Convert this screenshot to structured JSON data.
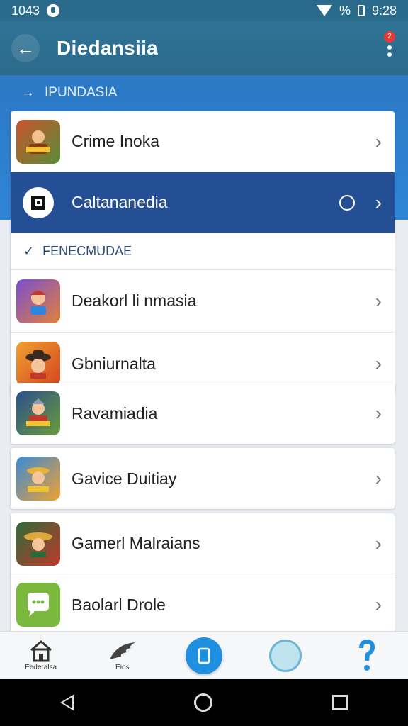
{
  "status_bar": {
    "left_text": "1043",
    "right_text": "%",
    "time": "9:28"
  },
  "app_bar": {
    "title": "Diedansiia",
    "badge_count": "2"
  },
  "section1": {
    "header": "IPUNDASIA",
    "rows": [
      {
        "label": "Crime Inoka",
        "icon": "game-icon-warrior"
      },
      {
        "label": "Caltananedia",
        "icon": "puzzle-icon",
        "selected": true
      }
    ]
  },
  "section2": {
    "header": "FENECMUDAE",
    "rows": [
      {
        "label": "Deakorl li nmasia",
        "icon": "game-icon-hero"
      },
      {
        "label": "Gbniurnalta",
        "icon": "game-icon-cowboy"
      }
    ]
  },
  "section3": {
    "rows": [
      {
        "label": "Ravamiadia",
        "icon": "game-icon-knight"
      }
    ]
  },
  "section4": {
    "rows": [
      {
        "label": "Gavice Duitiay",
        "icon": "game-icon-adventurer"
      }
    ]
  },
  "section5": {
    "rows": [
      {
        "label": "Gamerl Malraians",
        "icon": "game-icon-sombrero"
      },
      {
        "label": "Baolarl Drole",
        "icon": "chat-icon"
      }
    ]
  },
  "bottom_nav": {
    "home_label": "Eederalsa",
    "second_label": "Eios"
  },
  "colors": {
    "app_bar": "#2b6a8b",
    "selected_row": "#254f94",
    "accent": "#1f8fe0"
  }
}
